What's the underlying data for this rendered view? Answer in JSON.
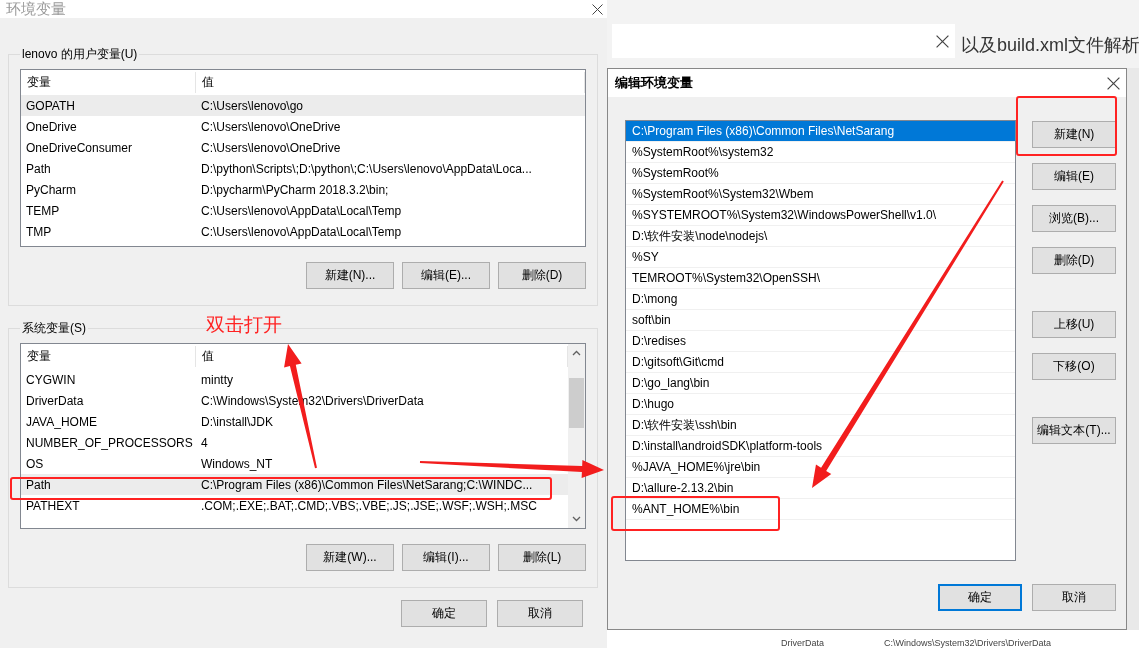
{
  "env_dialog": {
    "title": "环境变量",
    "user_vars": {
      "label": "lenovo 的用户变量(U)",
      "columns": [
        "变量",
        "值"
      ],
      "rows": [
        {
          "name": "GOPATH",
          "value": "C:\\Users\\lenovo\\go",
          "selected": true
        },
        {
          "name": "OneDrive",
          "value": "C:\\Users\\lenovo\\OneDrive",
          "selected": false
        },
        {
          "name": "OneDriveConsumer",
          "value": "C:\\Users\\lenovo\\OneDrive",
          "selected": false
        },
        {
          "name": "Path",
          "value": "D:\\python\\Scripts\\;D:\\python\\;C:\\Users\\lenovo\\AppData\\Loca...",
          "selected": false
        },
        {
          "name": "PyCharm",
          "value": "D:\\pycharm\\PyCharm 2018.3.2\\bin;",
          "selected": false
        },
        {
          "name": "TEMP",
          "value": "C:\\Users\\lenovo\\AppData\\Local\\Temp",
          "selected": false
        },
        {
          "name": "TMP",
          "value": "C:\\Users\\lenovo\\AppData\\Local\\Temp",
          "selected": false
        }
      ],
      "buttons": [
        "新建(N)...",
        "编辑(E)...",
        "删除(D)"
      ]
    },
    "system_vars": {
      "label": "系统变量(S)",
      "columns": [
        "变量",
        "值"
      ],
      "rows": [
        {
          "name": "CYGWIN",
          "value": "mintty",
          "selected": false
        },
        {
          "name": "DriverData",
          "value": "C:\\Windows\\System32\\Drivers\\DriverData",
          "selected": false
        },
        {
          "name": "JAVA_HOME",
          "value": "D:\\install\\JDK",
          "selected": false
        },
        {
          "name": "NUMBER_OF_PROCESSORS",
          "value": "4",
          "selected": false
        },
        {
          "name": "OS",
          "value": "Windows_NT",
          "selected": false
        },
        {
          "name": "Path",
          "value": "C:\\Program Files (x86)\\Common Files\\NetSarang;C:\\WINDC...",
          "selected": true
        },
        {
          "name": "PATHEXT",
          "value": ".COM;.EXE;.BAT;.CMD;.VBS;.VBE;.JS;.JSE;.WSF;.WSH;.MSC",
          "selected": false
        }
      ],
      "buttons": [
        "新建(W)...",
        "编辑(I)...",
        "删除(L)"
      ]
    },
    "buttons": [
      "确定",
      "取消"
    ]
  },
  "background": {
    "article_title": "以及build.xml文件解析",
    "peek_row": {
      "name": "DriverData",
      "value": "C:\\Windows\\System32\\Drivers\\DriverData"
    }
  },
  "edit_dialog": {
    "title": "编辑环境变量",
    "entries": [
      {
        "text": "C:\\Program Files (x86)\\Common Files\\NetSarang",
        "selected": true
      },
      {
        "text": "%SystemRoot%\\system32",
        "selected": false
      },
      {
        "text": "%SystemRoot%",
        "selected": false
      },
      {
        "text": "%SystemRoot%\\System32\\Wbem",
        "selected": false
      },
      {
        "text": "%SYSTEMROOT%\\System32\\WindowsPowerShell\\v1.0\\",
        "selected": false
      },
      {
        "text": "D:\\软件安装\\node\\nodejs\\",
        "selected": false
      },
      {
        "text": "%SY",
        "selected": false
      },
      {
        "text": "TEMROOT%\\System32\\OpenSSH\\",
        "selected": false
      },
      {
        "text": "D:\\mong",
        "selected": false
      },
      {
        "text": "soft\\bin",
        "selected": false
      },
      {
        "text": "D:\\redises",
        "selected": false
      },
      {
        "text": "D:\\gitsoft\\Git\\cmd",
        "selected": false
      },
      {
        "text": "D:\\go_lang\\bin",
        "selected": false
      },
      {
        "text": "D:\\hugo",
        "selected": false
      },
      {
        "text": "D:\\软件安装\\ssh\\bin",
        "selected": false
      },
      {
        "text": "D:\\install\\androidSDK\\platform-tools",
        "selected": false
      },
      {
        "text": "%JAVA_HOME%\\jre\\bin",
        "selected": false
      },
      {
        "text": "D:\\allure-2.13.2\\bin",
        "selected": false
      },
      {
        "text": "%ANT_HOME%\\bin",
        "selected": false
      }
    ],
    "side_button_groups": [
      [
        "新建(N)",
        "编辑(E)",
        "浏览(B)...",
        "删除(D)"
      ],
      [
        "上移(U)",
        "下移(O)"
      ],
      [
        "编辑文本(T)..."
      ]
    ],
    "footer_buttons": [
      {
        "label": "确定",
        "focused": true
      },
      {
        "label": "取消",
        "focused": false
      }
    ]
  },
  "annotation": {
    "label": "双击打开"
  }
}
